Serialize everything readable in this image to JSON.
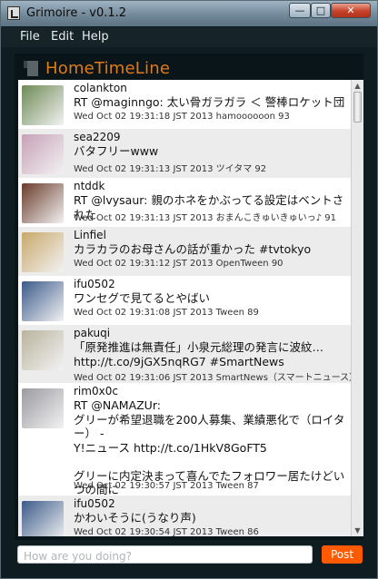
{
  "window": {
    "title": "Grimoire - v0.1.2",
    "buttons": {
      "minimize": "—",
      "maximize": "□",
      "close": "✕"
    }
  },
  "menu": {
    "items": [
      "File",
      "Edit",
      "Help"
    ]
  },
  "timeline": {
    "title": "HomeTimeLine",
    "icon": "bookmark-icon"
  },
  "tweets": [
    {
      "name": "colankton",
      "text": "RT @maginngo: 太い骨ガラガラ ＜ 警棒ロケット団",
      "meta": "Wed Oct 02 19:31:18 JST 2013 hamoooooon 93",
      "avatar_color": "#6e8a55"
    },
    {
      "name": "sea2209",
      "text": "バタフリーwww",
      "meta": "Wed Oct 02 19:31:13 JST 2013 ツイタマ 92",
      "avatar_color": "#c7a1b7"
    },
    {
      "name": "ntddk",
      "text": "RT @lvysaur: 親のホネをかぶってる設定はベントされた",
      "meta": "Wed Oct 02 19:31:13 JST 2013 おまんこきゅいきゅいっ♪ 91",
      "avatar_color": "#6a3b2a"
    },
    {
      "name": "Linfiel",
      "text": "カラカラのお母さんの話が重かった #tvtokyo",
      "meta": "Wed Oct 02 19:31:12 JST 2013 OpenTween 90",
      "avatar_color": "#c9a86a"
    },
    {
      "name": "ifu0502",
      "text": "ワンセグで見てるとやばい",
      "meta": "Wed Oct 02 19:31:08 JST 2013 Tween 89",
      "avatar_color": "#3b5a8a"
    },
    {
      "name": "pakuqi",
      "text": "「原発推進は無責任」小泉元総理の発言に波紋…\nhttp://t.co/9jGX5nqRG7 #SmartNews",
      "meta": "Wed Oct 02 19:31:06 JST 2013 SmartNews（スマートニュース） 88",
      "avatar_color": "#b9b39e"
    },
    {
      "name": "rim0x0c",
      "text": "RT @NAMAZUr:\nグリーが希望退職を200人募集、業績悪化で（ロイター） -\nY!ニュース http://t.co/1HkV8GoFT5\n\nグリーに内定決まって喜んでたフォロワー居たけどいつの間に\nかアカウント消してたな…。",
      "meta": "Wed Oct 02 19:30:57 JST 2013 Tween 87",
      "avatar_color": "#9a9aa0"
    },
    {
      "name": "ifu0502",
      "text": "かわいそうに(うなり声)",
      "meta": "Wed Oct 02 19:30:54 JST 2013 Tween 86",
      "avatar_color": "#3b5a8a"
    }
  ],
  "compose": {
    "placeholder": "How are you doing?",
    "value": ""
  },
  "post_button": {
    "label": "Post"
  },
  "colors": {
    "accent": "#ff5a00",
    "timeline_title": "#e07b18"
  }
}
